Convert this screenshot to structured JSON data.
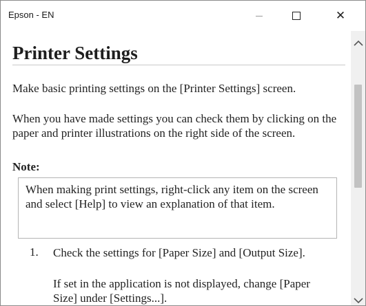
{
  "window": {
    "title": "Epson - EN",
    "controls": {
      "minimize": "minimize-icon",
      "maximize": "maximize-icon",
      "close": "close-icon"
    }
  },
  "page": {
    "heading": "Printer Settings",
    "paragraph_1": "Make basic printing settings on the [Printer Settings] screen.",
    "paragraph_2": "When you have made settings you can check them by clicking on the paper and printer illustrations on the right side of the screen.",
    "note_label": "Note:",
    "note_text": "When making print settings, right-click any item on the screen and select [Help] to view an explanation of that item.",
    "steps": [
      {
        "number": "1.",
        "text": "Check the settings for [Paper Size] and [Output Size].",
        "sub": "If set in the application is not displayed, change [Paper Size] under [Settings...]."
      }
    ]
  },
  "colors": {
    "text": "#222222",
    "rule": "#c8c8c8",
    "note_border": "#b4b4b4",
    "scrollbar_track": "#f0f0f0",
    "scrollbar_thumb": "#c2c2c2"
  }
}
